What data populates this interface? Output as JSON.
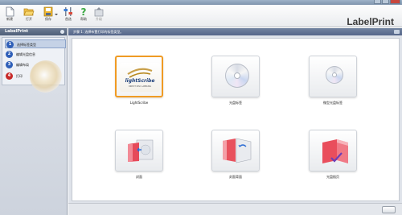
{
  "window": {
    "title": ""
  },
  "toolbar": {
    "items": [
      {
        "label": "新建",
        "icon": "new-file-icon"
      },
      {
        "label": "打开",
        "icon": "open-folder-icon"
      },
      {
        "label": "保存",
        "icon": "save-icon"
      },
      {
        "label": "首选",
        "icon": "preferences-icon"
      },
      {
        "label": "帮助",
        "icon": "help-icon"
      },
      {
        "label": "升级",
        "icon": "upgrade-icon"
      }
    ],
    "brand": "LabelPrint"
  },
  "left_panel": {
    "title": "LabelPrint",
    "steps": [
      {
        "number": "1",
        "label": "选择标签类型",
        "color": "#2f5fb8",
        "active": true
      },
      {
        "number": "2",
        "label": "编辑光盘信息",
        "color": "#2f5fb8",
        "active": false
      },
      {
        "number": "3",
        "label": "编辑布局",
        "color": "#2f5fb8",
        "active": false
      },
      {
        "number": "4",
        "label": "打印",
        "color": "#c72a2a",
        "active": false
      }
    ]
  },
  "main": {
    "step_header": "步骤 1. 选择布置打印的标签类型。",
    "options": [
      {
        "label": "LightScribe",
        "selected": true
      },
      {
        "label": "光盘标签",
        "selected": false
      },
      {
        "label": "微型光盘标签",
        "selected": false
      },
      {
        "label": "封面",
        "selected": false
      },
      {
        "label": "封面背面",
        "selected": false
      },
      {
        "label": "光盘插页",
        "selected": false
      }
    ],
    "lightscribe_logo": {
      "text": "lightScribe",
      "tagline": "DIRECT DISC LABELING"
    }
  },
  "colors": {
    "accent": "#f09b24",
    "header": "#5e6f8f",
    "next_arrow": "#2aa52a"
  }
}
